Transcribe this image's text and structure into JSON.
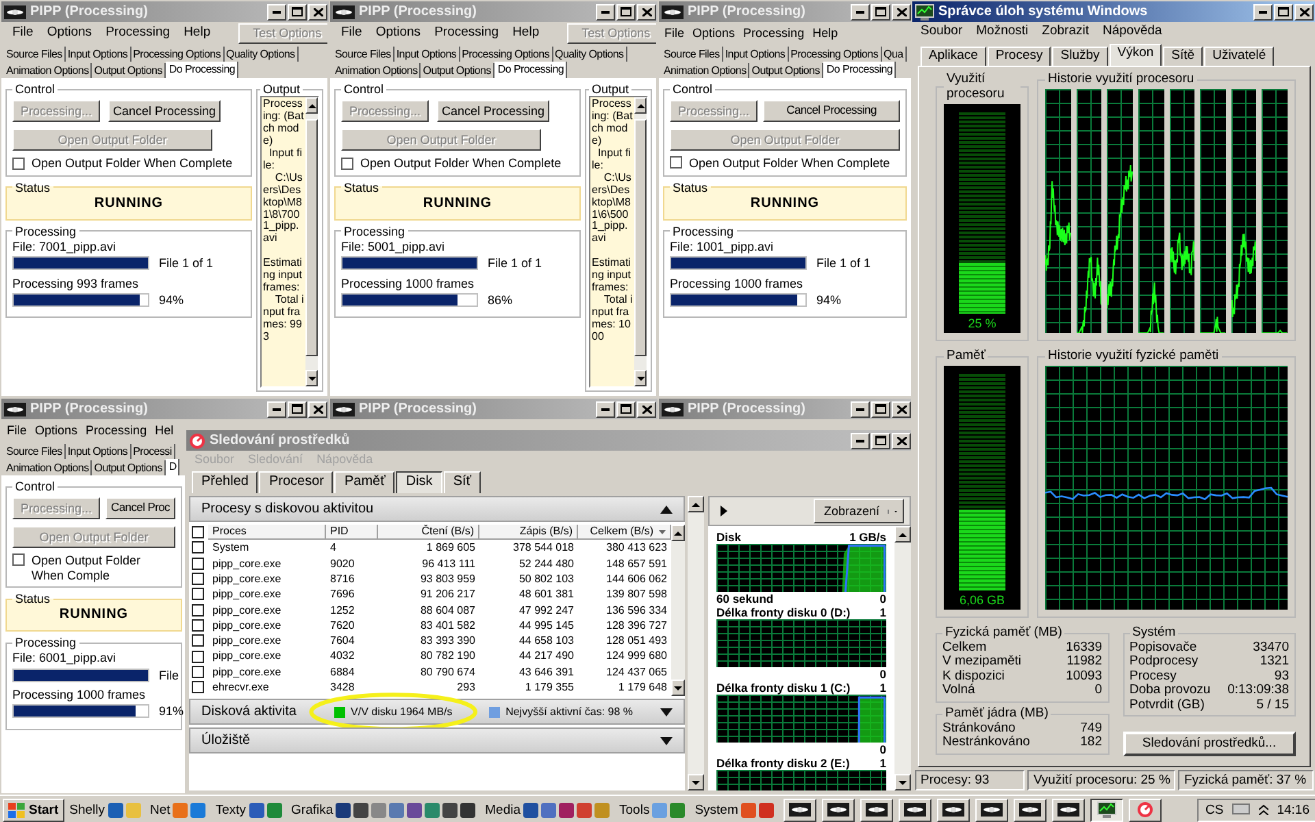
{
  "pipp_windows": [
    {
      "title": "PIPP (Processing)",
      "active": false,
      "menu": [
        "File",
        "Options",
        "Processing",
        "Help"
      ],
      "test_options": {
        "label": "Test Options",
        "disabled": true
      },
      "tab_rows": [
        [
          {
            "label": "Source Files",
            "selected": false
          },
          {
            "label": "Input Options",
            "selected": false
          },
          {
            "label": "Processing Options",
            "selected": false
          },
          {
            "label": "Quality Options",
            "selected": false
          }
        ],
        [
          {
            "label": "Animation Options",
            "selected": false
          },
          {
            "label": "Output Options",
            "selected": false
          },
          {
            "label": "Do Processing",
            "selected": true
          }
        ]
      ],
      "control": {
        "title": "Control",
        "buttons": [
          {
            "label": "Processing...",
            "disabled": true
          },
          {
            "label": "Cancel Processing",
            "disabled": false
          }
        ],
        "open_button": {
          "label": "Open Output Folder",
          "disabled": true
        },
        "checkbox": {
          "label": "Open Output Folder When Complete",
          "checked": false
        }
      },
      "status": {
        "title": "Status",
        "value": "RUNNING"
      },
      "processing": {
        "title": "Processing",
        "file": "File: 7001_pipp.avi",
        "file_progress": {
          "level": 1
        },
        "file_count": "File 1 of 1",
        "frames": "Processing 993 frames",
        "frames_progress": {
          "level": 0.94
        },
        "percent": "94%"
      },
      "output": {
        "title": "Output",
        "text": "Processing: (Batch mode)\n  Input file:\n    C:\\Users\\Desktop\\M81\\8\\7001_pipp.avi\n\nEstimating input frames:\n    Total input frames: 993"
      }
    },
    {
      "title": "PIPP (Processing)",
      "active": false,
      "menu": [
        "File",
        "Options",
        "Processing",
        "Help"
      ],
      "test_options": {
        "label": "Test Options",
        "disabled": true
      },
      "tab_rows": [
        [
          {
            "label": "Source Files",
            "selected": false
          },
          {
            "label": "Input Options",
            "selected": false
          },
          {
            "label": "Processing Options",
            "selected": false
          },
          {
            "label": "Quality Options",
            "selected": false
          }
        ],
        [
          {
            "label": "Animation Options",
            "selected": false
          },
          {
            "label": "Output Options",
            "selected": false
          },
          {
            "label": "Do Processing",
            "selected": true
          }
        ]
      ],
      "control": {
        "title": "Control",
        "buttons": [
          {
            "label": "Processing...",
            "disabled": true
          },
          {
            "label": "Cancel Processing",
            "disabled": false
          }
        ],
        "open_button": {
          "label": "Open Output Folder",
          "disabled": true
        },
        "checkbox": {
          "label": "Open Output Folder When Complete",
          "checked": false
        }
      },
      "status": {
        "title": "Status",
        "value": "RUNNING"
      },
      "processing": {
        "title": "Processing",
        "file": "File: 5001_pipp.avi",
        "file_progress": {
          "level": 1
        },
        "file_count": "File 1 of 1",
        "frames": "Processing 1000 frames",
        "frames_progress": {
          "level": 0.86
        },
        "percent": "86%"
      },
      "output": {
        "title": "Output",
        "text": "Processing: (Batch mode)\n  Input file:\n    C:\\Users\\Desktop\\M81\\6\\5001_pipp.avi\n\nEstimating input frames:\n    Total input frames: 1000"
      }
    },
    {
      "title": "PIPP (Processing)",
      "active": false,
      "menu": [
        "File",
        "Options",
        "Processing",
        "Help"
      ],
      "tab_rows": [
        [
          {
            "label": "Source Files",
            "selected": false
          },
          {
            "label": "Input Options",
            "selected": false
          },
          {
            "label": "Processing Options",
            "selected": false
          },
          {
            "label": "Qua",
            "selected": false
          }
        ],
        [
          {
            "label": "Animation Options",
            "selected": false
          },
          {
            "label": "Output Options",
            "selected": false
          },
          {
            "label": "Do Processing",
            "selected": true
          }
        ]
      ],
      "control": {
        "title": "Control",
        "buttons": [
          {
            "label": "Processing...",
            "disabled": true
          },
          {
            "label": "Cancel Processing",
            "disabled": false
          }
        ],
        "open_button": {
          "label": "Open Output Folder",
          "disabled": true
        },
        "checkbox": {
          "label": "Open Output Folder When Complete",
          "checked": false
        }
      },
      "status": {
        "title": "Status",
        "value": "RUNNING"
      },
      "processing": {
        "title": "Processing",
        "file": "File: 1001_pipp.avi",
        "file_progress": {
          "level": 1
        },
        "file_count": "File 1 of 1",
        "frames": "Processing 1000 frames",
        "frames_progress": {
          "level": 0.94
        },
        "percent": "94%"
      }
    },
    {
      "title": "PIPP (Processing)",
      "active": false,
      "menu": [
        "File",
        "Options",
        "Processing",
        "Hel"
      ],
      "tab_rows": [
        [
          {
            "label": "Source Files",
            "selected": false
          },
          {
            "label": "Input Options",
            "selected": false
          },
          {
            "label": "Processi",
            "selected": false
          }
        ],
        [
          {
            "label": "Animation Options",
            "selected": false
          },
          {
            "label": "Output Options",
            "selected": false
          },
          {
            "label": "D",
            "selected": true
          }
        ]
      ],
      "control": {
        "title": "Control",
        "buttons": [
          {
            "label": "Processing...",
            "disabled": true
          },
          {
            "label": "Cancel Proc",
            "disabled": false
          }
        ],
        "open_button": {
          "label": "Open Output Folder",
          "disabled": true
        },
        "checkbox": {
          "label": "Open Output Folder When Comple",
          "checked": false
        }
      },
      "status": {
        "title": "Status",
        "value": "RUNNING"
      },
      "processing": {
        "title": "Processing",
        "file": "File: 6001_pipp.avi",
        "file_progress": {
          "level": 1
        },
        "file_count": "File",
        "frames": "Processing 1000 frames",
        "frames_progress": {
          "level": 0.91
        },
        "percent": "91%"
      }
    },
    {
      "title": "PIPP (Processing)",
      "active": false
    },
    {
      "title": "PIPP (Processing)",
      "active": false
    }
  ],
  "resource_monitor": {
    "title": "Sledování prostředků",
    "active": false,
    "menu": [
      {
        "label": "Soubor",
        "disabled": true
      },
      {
        "label": "Sledování",
        "disabled": true
      },
      {
        "label": "Nápověda",
        "disabled": true
      }
    ],
    "tabs": [
      {
        "label": "Přehled",
        "selected": false
      },
      {
        "label": "Procesor",
        "selected": false
      },
      {
        "label": "Paměť",
        "selected": false
      },
      {
        "label": "Disk",
        "selected": true
      },
      {
        "label": "Síť",
        "selected": false
      }
    ],
    "processes": {
      "title": "Procesy s diskovou aktivitou",
      "expanded": true,
      "all_checked": false,
      "columns": [
        "Proces",
        "PID",
        "Čtení (B/s)",
        "Zápis (B/s)",
        "Celkem (B/s)"
      ],
      "rows": [
        {
          "checked": false,
          "cells": [
            "System",
            "4",
            "1 869 605",
            "378 544 018",
            "380 413 623"
          ]
        },
        {
          "checked": false,
          "cells": [
            "pipp_core.exe",
            "9020",
            "96 413 111",
            "52 244 480",
            "148 657 591"
          ]
        },
        {
          "checked": false,
          "cells": [
            "pipp_core.exe",
            "8716",
            "93 803 959",
            "50 802 103",
            "144 606 062"
          ]
        },
        {
          "checked": false,
          "cells": [
            "pipp_core.exe",
            "7696",
            "91 206 217",
            "48 601 381",
            "139 807 598"
          ]
        },
        {
          "checked": false,
          "cells": [
            "pipp_core.exe",
            "1252",
            "88 604 087",
            "47 992 247",
            "136 596 334"
          ]
        },
        {
          "checked": false,
          "cells": [
            "pipp_core.exe",
            "7620",
            "83 401 582",
            "44 995 145",
            "128 396 727"
          ]
        },
        {
          "checked": false,
          "cells": [
            "pipp_core.exe",
            "7604",
            "83 393 390",
            "44 658 103",
            "128 051 493"
          ]
        },
        {
          "checked": false,
          "cells": [
            "pipp_core.exe",
            "4032",
            "80 782 190",
            "44 217 490",
            "124 999 680"
          ]
        },
        {
          "checked": false,
          "cells": [
            "pipp_core.exe",
            "6884",
            "80 790 674",
            "43 646 391",
            "124 437 065"
          ]
        },
        {
          "checked": false,
          "cells": [
            "ehrecvr.exe",
            "3428",
            "293",
            "1 179 355",
            "1 179 648"
          ]
        }
      ]
    },
    "disk_activity": {
      "title": "Disková aktivita",
      "expanded": false,
      "items": [
        {
          "text": "V/V disku 1964 MB/s",
          "color": "#00c000"
        },
        {
          "text": "Nejvyšší aktivní čas: 98 %",
          "color": "#6f9ee0"
        }
      ]
    },
    "storage": {
      "title": "Úložiště",
      "expanded": false
    },
    "view_button": "Zobrazení",
    "graphs": [
      {
        "title": "Disk",
        "max": "1 GB/s",
        "caption": "60 sekund",
        "min": "0"
      },
      {
        "title": "Délka fronty disku 0 (D:)",
        "max": "1",
        "min": "0"
      },
      {
        "title": "Délka fronty disku 1 (C:)",
        "max": "1",
        "min": "0"
      },
      {
        "title": "Délka fronty disku 2 (E:)",
        "max": "1"
      }
    ]
  },
  "task_manager": {
    "title": "Správce úloh systému Windows",
    "active": true,
    "menu": [
      "Soubor",
      "Možnosti",
      "Zobrazit",
      "Nápověda"
    ],
    "tabs": [
      {
        "label": "Aplikace",
        "selected": false
      },
      {
        "label": "Procesy",
        "selected": false
      },
      {
        "label": "Služby",
        "selected": false
      },
      {
        "label": "Výkon",
        "selected": true
      },
      {
        "label": "Sítě",
        "selected": false
      },
      {
        "label": "Uživatelé",
        "selected": false
      }
    ],
    "cpu": {
      "title": "Využití procesoru",
      "level": 0.25,
      "reading": "25 %"
    },
    "cpu_history": {
      "title": "Historie využití procesoru"
    },
    "memory": {
      "title": "Paměť",
      "level": 0.37,
      "reading": "6,06 GB"
    },
    "memory_history": {
      "title": "Historie využití fyzické paměti"
    },
    "physical": {
      "title": "Fyzická paměť (MB)",
      "rows": [
        {
          "label": "Celkem",
          "value": "16339"
        },
        {
          "label": "V mezipaměti",
          "value": "11982"
        },
        {
          "label": "K dispozici",
          "value": "10093"
        },
        {
          "label": "Volná",
          "value": "0"
        }
      ]
    },
    "kernel": {
      "title": "Paměť jádra (MB)",
      "rows": [
        {
          "label": "Stránkováno",
          "value": "749"
        },
        {
          "label": "Nestránkováno",
          "value": "182"
        }
      ]
    },
    "system": {
      "title": "Systém",
      "rows": [
        {
          "label": "Popisovače",
          "value": "33470"
        },
        {
          "label": "Podprocesy",
          "value": "1321"
        },
        {
          "label": "Procesy",
          "value": "93"
        },
        {
          "label": "Doba provozu",
          "value": "0:13:09:38"
        },
        {
          "label": "Potvrdit (GB)",
          "value": "5 / 15"
        }
      ]
    },
    "monitor_button": "Sledování prostředků...",
    "status_bar": [
      "Procesy: 93",
      "Využití procesoru: 25 %",
      "Fyzická paměť: 37 %"
    ]
  },
  "taskbar": {
    "start": "Start",
    "groups": [
      {
        "label": "Shelly"
      },
      {
        "label": "Net"
      },
      {
        "label": "Texty"
      },
      {
        "label": "Grafika"
      },
      {
        "label": "Media"
      },
      {
        "label": "Tools"
      },
      {
        "label": "System"
      }
    ],
    "tasks": [
      {
        "kind": "pipp",
        "selected": false
      },
      {
        "kind": "pipp",
        "selected": false
      },
      {
        "kind": "pipp",
        "selected": false
      },
      {
        "kind": "pipp",
        "selected": false
      },
      {
        "kind": "pipp",
        "selected": false
      },
      {
        "kind": "pipp",
        "selected": false
      },
      {
        "kind": "pipp",
        "selected": false
      },
      {
        "kind": "pipp",
        "selected": false
      },
      {
        "kind": "taskmgr",
        "selected": true
      },
      {
        "kind": "resmon",
        "selected": false
      }
    ],
    "language": "CS",
    "clock": "14:16"
  }
}
